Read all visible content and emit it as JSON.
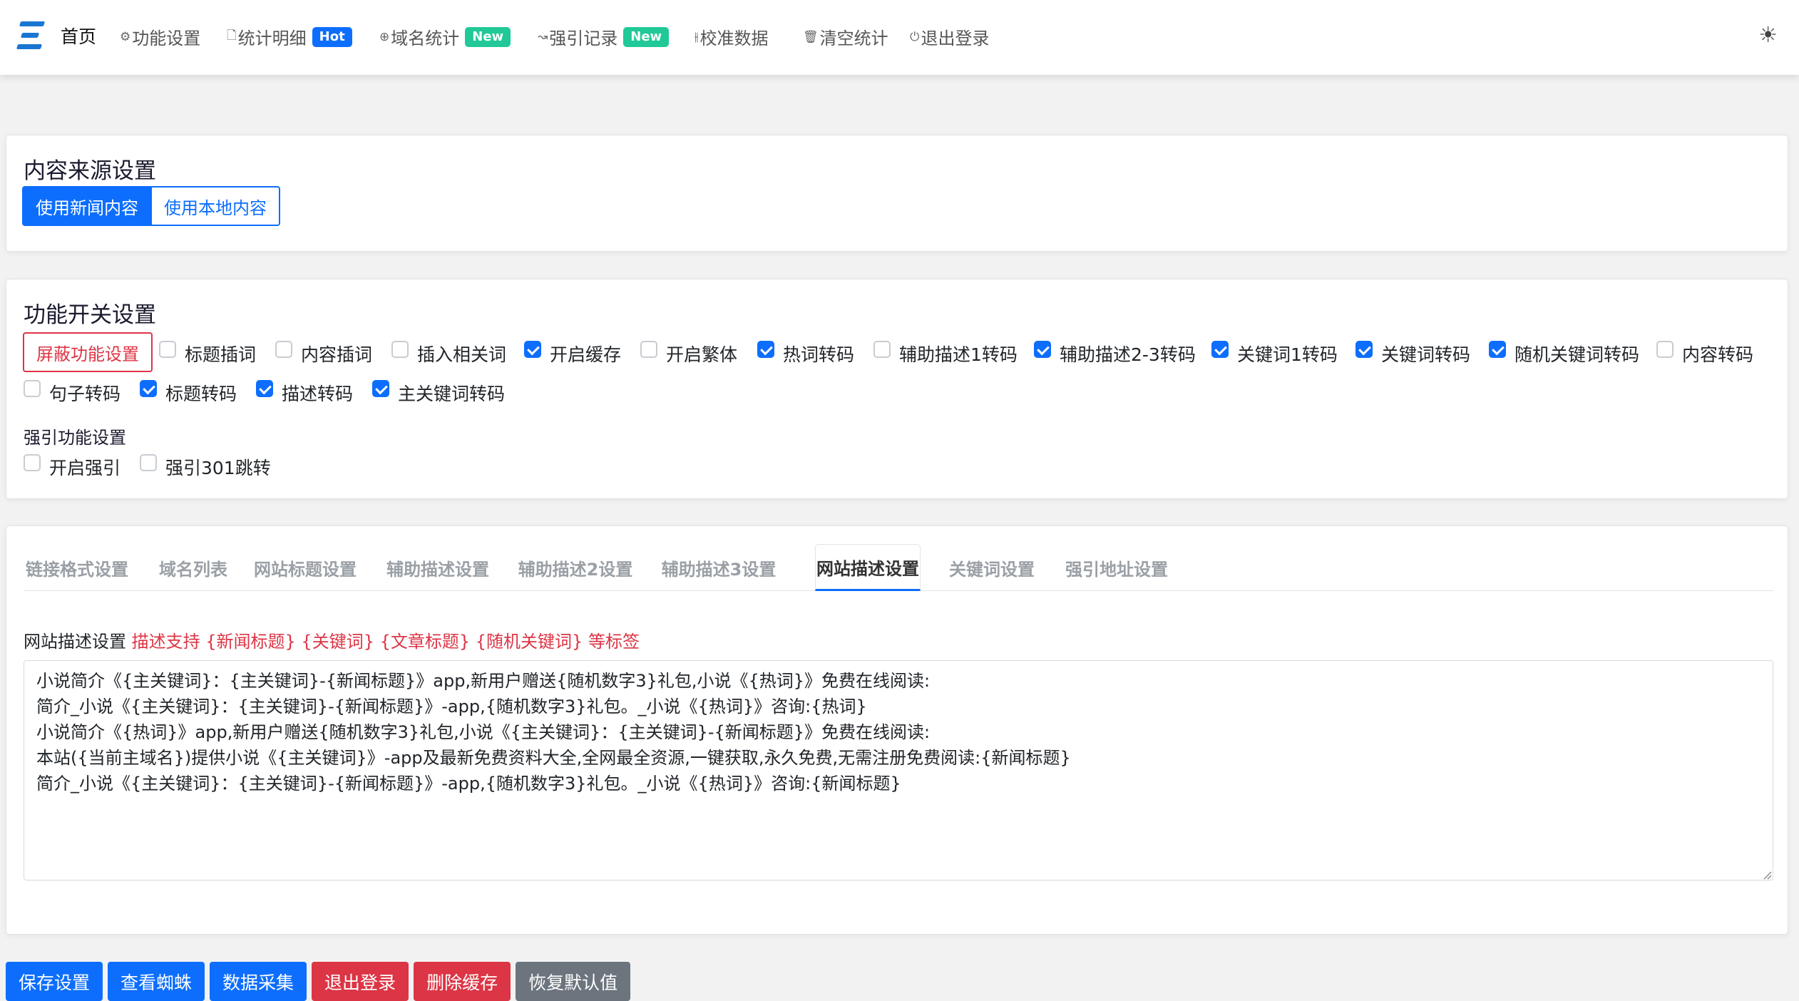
{
  "nav": {
    "home": "首页",
    "items": [
      {
        "icon": "gear-icon",
        "glyph": "⚙",
        "label": "功能设置"
      },
      {
        "icon": "file-icon",
        "glyph": "🗋",
        "label": "统计明细",
        "badge": "Hot"
      },
      {
        "icon": "globe-icon",
        "glyph": "⊕",
        "label": "域名统计",
        "badge": "New"
      },
      {
        "icon": "route-icon",
        "glyph": "↝",
        "label": "强引记录",
        "badge": "New"
      },
      {
        "icon": "sliders-icon",
        "glyph": "⫲",
        "label": "校准数据"
      },
      {
        "icon": "trash-icon",
        "glyph": "🗑",
        "label": "清空统计"
      },
      {
        "icon": "power-icon",
        "glyph": "⏻",
        "label": "退出登录"
      }
    ],
    "theme_icon": "☀"
  },
  "content_source": {
    "title": "内容来源设置",
    "options": [
      "使用新闻内容",
      "使用本地内容"
    ]
  },
  "feature_switch": {
    "title": "功能开关设置",
    "block_button": "屏蔽功能设置",
    "checkboxes": [
      {
        "label": "标题插词",
        "checked": false
      },
      {
        "label": "内容插词",
        "checked": false
      },
      {
        "label": "插入相关词",
        "checked": false
      },
      {
        "label": "开启缓存",
        "checked": true
      },
      {
        "label": "开启繁体",
        "checked": false
      },
      {
        "label": "热词转码",
        "checked": true
      },
      {
        "label": "辅助描述1转码",
        "checked": false
      },
      {
        "label": "辅助描述2-3转码",
        "checked": true
      },
      {
        "label": "关键词1转码",
        "checked": true
      },
      {
        "label": "关键词转码",
        "checked": true
      },
      {
        "label": "随机关键词转码",
        "checked": true
      },
      {
        "label": "内容转码",
        "checked": false
      },
      {
        "label": "句子转码",
        "checked": false
      },
      {
        "label": "标题转码",
        "checked": true
      },
      {
        "label": "描述转码",
        "checked": true
      },
      {
        "label": "主关键词转码",
        "checked": true
      }
    ],
    "redirect_title": "强引功能设置",
    "redirect_checkboxes": [
      {
        "label": "开启强引",
        "checked": false
      },
      {
        "label": "强引301跳转",
        "checked": false
      }
    ]
  },
  "tabs": {
    "items": [
      "链接格式设置",
      "域名列表",
      "网站标题设置",
      "辅助描述设置",
      "辅助描述2设置",
      "辅助描述3设置",
      "网站描述设置",
      "关键词设置",
      "强引地址设置"
    ],
    "active": "网站描述设置"
  },
  "description": {
    "label": "网站描述设置",
    "hint": "描述支持 {新闻标题} {关键词} {文章标题} {随机关键词} 等标签",
    "value": "小说简介《{主关键词}：{主关键词}-{新闻标题}》app,新用户赠送{随机数字3}礼包,小说《{热词}》免费在线阅读:\n简介_小说《{主关键词}：{主关键词}-{新闻标题}》-app,{随机数字3}礼包。_小说《{热词}》咨询:{热词}\n小说简介《{热词}》app,新用户赠送{随机数字3}礼包,小说《{主关键词}：{主关键词}-{新闻标题}》免费在线阅读:\n本站({当前主域名})提供小说《{主关键词}》-app及最新免费资料大全,全网最全资源,一键获取,永久免费,无需注册免费阅读:{新闻标题}\n简介_小说《{主关键词}：{主关键词}-{新闻标题}》-app,{随机数字3}礼包。_小说《{热词}》咨询:{新闻标题}"
  },
  "actions": {
    "save": "保存设置",
    "spider": "查看蜘蛛",
    "collect": "数据采集",
    "logout": "退出登录",
    "clear_cache": "删除缓存",
    "reset": "恢复默认值"
  },
  "colors": {
    "primary": "#0d6efd",
    "danger": "#dc3545",
    "secondary": "#6c757d",
    "success": "#20c997"
  }
}
